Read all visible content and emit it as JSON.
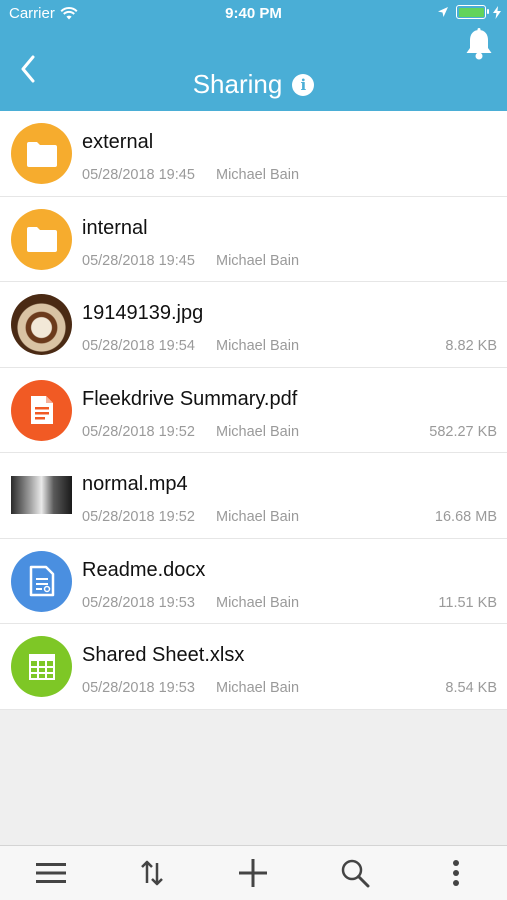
{
  "status_bar": {
    "carrier": "Carrier",
    "time": "9:40 PM",
    "battery_level": 1.0
  },
  "header": {
    "title": "Sharing",
    "info_glyph": "i",
    "back_icon": "chevron-left-icon",
    "notification_icon": "bell-icon"
  },
  "colors": {
    "header": "#4aaed6",
    "folder": "#f6ac2e",
    "pdf": "#f15a24",
    "docx": "#4a8fe0",
    "xlsx": "#7ec726",
    "meta_text": "#9a9a9a"
  },
  "files": [
    {
      "name": "external",
      "date": "05/28/2018 19:45",
      "owner": "Michael Bain",
      "size": "",
      "icon": "folder-icon"
    },
    {
      "name": "internal",
      "date": "05/28/2018 19:45",
      "owner": "Michael Bain",
      "size": "",
      "icon": "folder-icon"
    },
    {
      "name": "19149139.jpg",
      "date": "05/28/2018 19:54",
      "owner": "Michael Bain",
      "size": "8.82 KB",
      "icon": "image-thumbnail"
    },
    {
      "name": "Fleekdrive Summary.pdf",
      "date": "05/28/2018 19:52",
      "owner": "Michael Bain",
      "size": "582.27 KB",
      "icon": "pdf-icon"
    },
    {
      "name": "normal.mp4",
      "date": "05/28/2018 19:52",
      "owner": "Michael Bain",
      "size": "16.68 MB",
      "icon": "video-thumbnail"
    },
    {
      "name": "Readme.docx",
      "date": "05/28/2018 19:53",
      "owner": "Michael Bain",
      "size": "11.51 KB",
      "icon": "document-icon"
    },
    {
      "name": "Shared Sheet.xlsx",
      "date": "05/28/2018 19:53",
      "owner": "Michael Bain",
      "size": "8.54 KB",
      "icon": "spreadsheet-icon"
    }
  ],
  "toolbar": [
    "menu-icon",
    "sort-icon",
    "add-icon",
    "search-icon",
    "more-icon"
  ]
}
